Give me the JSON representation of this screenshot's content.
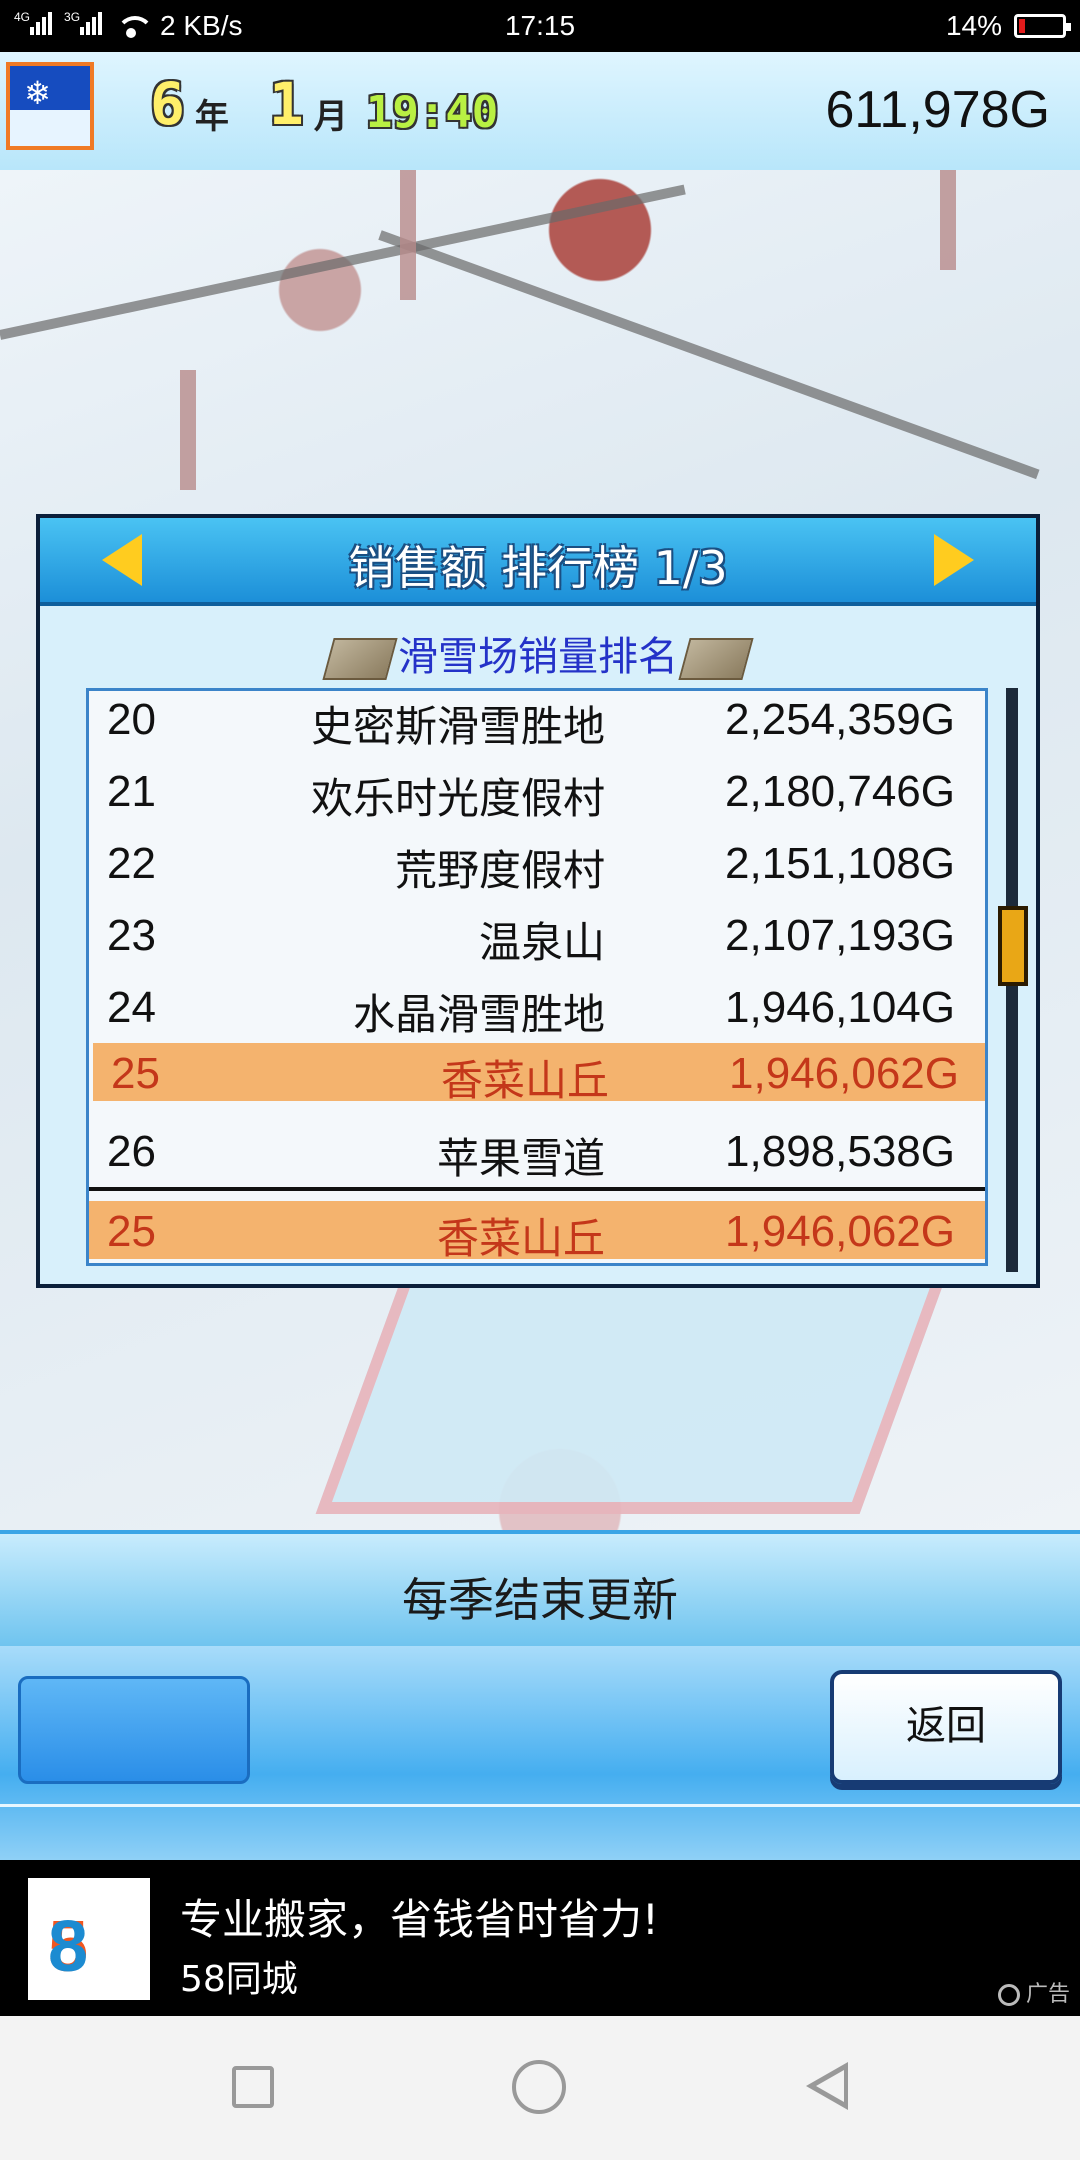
{
  "status_bar": {
    "network_1": "4G",
    "network_2": "3G",
    "speed": "2 KB/s",
    "time": "17:15",
    "battery_percent": "14%",
    "battery_level": 0.14
  },
  "game_header": {
    "year_value": "6",
    "year_unit": "年",
    "month_value": "1",
    "month_unit": "月",
    "clock": "19:40",
    "money": "611,978G"
  },
  "ranking_panel": {
    "title": "销售额 排行榜 1/3",
    "subtitle": "滑雪场销量排名",
    "rows": [
      {
        "rank": "20",
        "name": "史密斯滑雪胜地",
        "amount": "2,254,359G",
        "highlight": false
      },
      {
        "rank": "21",
        "name": "欢乐时光度假村",
        "amount": "2,180,746G",
        "highlight": false
      },
      {
        "rank": "22",
        "name": "荒野度假村",
        "amount": "2,151,108G",
        "highlight": false
      },
      {
        "rank": "23",
        "name": "温泉山",
        "amount": "2,107,193G",
        "highlight": false
      },
      {
        "rank": "24",
        "name": "水晶滑雪胜地",
        "amount": "1,946,104G",
        "highlight": false
      },
      {
        "rank": "25",
        "name": "香菜山丘",
        "amount": "1,946,062G",
        "highlight": true
      },
      {
        "rank": "26",
        "name": "苹果雪道",
        "amount": "1,898,538G",
        "highlight": false
      }
    ],
    "own_entry": {
      "rank": "25",
      "name": "香菜山丘",
      "amount": "1,946,062G"
    }
  },
  "info_bar": {
    "text": "每季结束更新"
  },
  "buttons": {
    "back_label": "返回"
  },
  "ad": {
    "logo_5": "5",
    "logo_8": "8",
    "headline": "专业搬家，省钱省时省力!",
    "brand": "58同城",
    "tag": "广告"
  },
  "colors": {
    "highlight_row": "#f4b36e",
    "highlight_text": "#c4371a",
    "title_bar": "#1c8fd8",
    "money_text": "#111111"
  }
}
